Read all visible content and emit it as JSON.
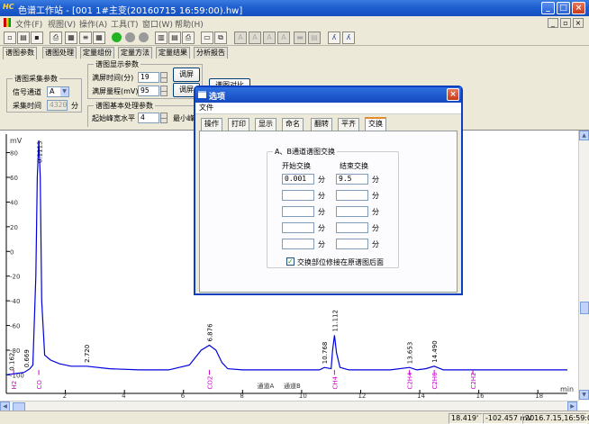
{
  "window": {
    "title": "色谱工作站 - [001 1#主变(20160715 16:59:00).hw]",
    "app_icon_text": "HC",
    "min_label": "_",
    "max_label": "□",
    "close_label": "×",
    "mdi_min_label": "_",
    "mdi_restore_label": "▫",
    "mdi_close_label": "×"
  },
  "menu": [
    "文件(F)",
    "视图(V)",
    "操作(A)",
    "工具(T)",
    "窗口(W)",
    "帮助(H)"
  ],
  "toolbar": {
    "icons": [
      "new-icon",
      "open-icon",
      "save-icon",
      "export-icon",
      "chart-icon",
      "scale-icon",
      "grid-icon",
      "run-icon",
      "pause-icon",
      "stop-icon",
      "calc-icon",
      "report-icon",
      "print-icon",
      "window-icon",
      "copy-icon",
      "dim-a",
      "dim-b",
      "dim-c",
      "dim-d",
      "dim-e",
      "dim-f",
      "dim-g",
      "person-icon",
      "person2-icon"
    ],
    "colors": {
      "run": "#22b222",
      "pause": "#9a9a9a",
      "stop": "#9a9a9a"
    }
  },
  "main_tabs": [
    "谱图参数",
    "谱图处理",
    "定量组份",
    "定量方法",
    "定量结果",
    "分析报告"
  ],
  "acquire": {
    "group_title": "谱图采集参数",
    "channel_label": "信号通道",
    "channel_value": "A",
    "time_label": "采集时间",
    "time_value": "4320",
    "time_unit": "分"
  },
  "display": {
    "group_title": "谱图显示参数",
    "screen_time_label": "满屏时间(分)",
    "screen_time_value": "19",
    "screen_range_label": "满屏量程(mV)",
    "screen_range_value": "95",
    "adjust_label": "调屏",
    "adjust2_label": "调屏",
    "compare_label": "谱图对比"
  },
  "basic": {
    "group_title": "谱图基本处理参数",
    "baseline_label": "起始峰宽水平",
    "baseline_value": "4",
    "min_label": "最小峰"
  },
  "dialog": {
    "title": "选项",
    "close_label": "×",
    "menu": "文件",
    "tabs": [
      "操作",
      "打印",
      "显示",
      "命名",
      "翻转",
      "平齐",
      "交换"
    ],
    "group_title": "A、B通道谱图交换",
    "col_start": "开始交换",
    "col_end": "结束交换",
    "unit": "分",
    "rows": [
      {
        "start": "0.001",
        "end": "9.5"
      },
      {
        "start": "",
        "end": ""
      },
      {
        "start": "",
        "end": ""
      },
      {
        "start": "",
        "end": ""
      },
      {
        "start": "",
        "end": ""
      }
    ],
    "checkbox_label": "交换部位修接在原谱图后面",
    "checkbox_checked": true
  },
  "chart_data": {
    "type": "line",
    "ylabel": "mV",
    "xlabel": "min",
    "xlim": [
      0,
      19
    ],
    "ylim": [
      -115,
      95
    ],
    "y_ticks": [
      -100,
      -80,
      -60,
      -40,
      -20,
      0,
      20,
      40,
      60,
      80
    ],
    "y_tick_labels": [
      "-100",
      "-80",
      "-60",
      "-40",
      "-20",
      "0",
      "20",
      "40",
      "60",
      "80"
    ],
    "x_ticks": [
      2,
      4,
      6,
      8,
      10,
      12,
      14,
      16,
      18
    ],
    "x_tick_labels": [
      "2",
      "4",
      "6",
      "8",
      "10",
      "12",
      "14",
      "16",
      "18"
    ],
    "colors": {
      "line": "#0000dd",
      "peak_label": "#000000",
      "component": "#cc00cc",
      "baseline_mark": "#22aa88",
      "channel_tick": "#0000dd"
    },
    "series": [
      {
        "x": [
          0,
          0.6,
          0.8,
          0.9,
          1.0,
          1.05,
          1.1,
          1.15,
          1.2,
          1.3,
          1.5,
          1.8,
          2.2,
          2.72,
          3.5,
          4.5,
          5.5,
          6.2,
          6.6,
          6.876,
          7.1,
          7.3,
          7.5,
          8.0,
          9.0,
          10.0,
          10.6,
          10.768,
          11.0,
          11.05,
          11.112,
          11.18,
          11.3,
          11.6,
          12.5,
          13.0,
          13.653,
          13.9,
          14.2,
          14.49,
          14.8,
          15.5,
          17.0,
          19.0
        ],
        "y": [
          -100,
          -98,
          -95,
          -92,
          -20,
          60,
          90,
          60,
          -40,
          -84,
          -88,
          -91,
          -93,
          -93,
          -95,
          -96,
          -96,
          -92,
          -80,
          -76,
          -80,
          -90,
          -95,
          -96,
          -96,
          -96,
          -96,
          -94,
          -95,
          -80,
          -68,
          -82,
          -94,
          -96,
          -96,
          -96,
          -94,
          -96,
          -95,
          -93,
          -96,
          -96,
          -96,
          -96
        ]
      }
    ],
    "peak_labels": [
      {
        "x": 0.162,
        "label": "0.162"
      },
      {
        "x": 0.669,
        "label": "0.669"
      },
      {
        "x": 1.113,
        "label": "0.1113"
      },
      {
        "x": 2.72,
        "label": "2.720"
      },
      {
        "x": 6.876,
        "label": "6.876"
      },
      {
        "x": 10.768,
        "label": "10.768"
      },
      {
        "x": 11.112,
        "label": "11.112"
      },
      {
        "x": 13.653,
        "label": "13.653"
      },
      {
        "x": 14.49,
        "label": "14.490"
      }
    ],
    "components": [
      {
        "x": 0.25,
        "label": "H2"
      },
      {
        "x": 1.1,
        "label": "CO"
      },
      {
        "x": 6.876,
        "label": "CO2"
      },
      {
        "x": 11.112,
        "label": "CH4"
      },
      {
        "x": 13.653,
        "label": "C2H4"
      },
      {
        "x": 14.49,
        "label": "C2H6"
      },
      {
        "x": 15.8,
        "label": "C2H2"
      }
    ],
    "channel_labels": [
      {
        "x": 8.8,
        "label": "通道A"
      },
      {
        "x": 9.7,
        "label": "通道B"
      }
    ]
  },
  "status": {
    "cells": [
      "18.419'",
      "-102.457 mV",
      "2016.7.15,16:59:00"
    ]
  }
}
